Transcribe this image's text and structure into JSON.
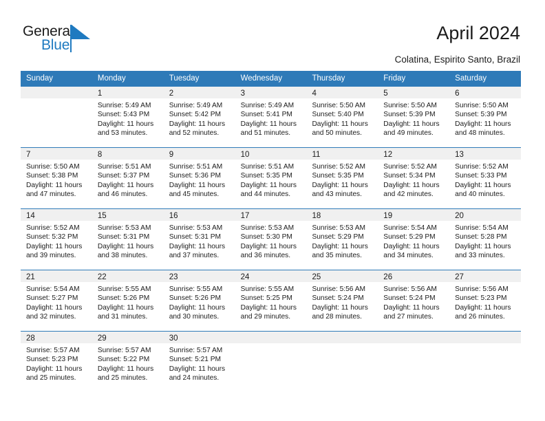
{
  "logo": {
    "text_top": "General",
    "text_bottom": "Blue",
    "triangle_color": "#1f7ac0",
    "icon": "general-blue-logo"
  },
  "header": {
    "title": "April 2024",
    "subtitle": "Colatina, Espirito Santo, Brazil"
  },
  "colors": {
    "header_blue": "#2e7ab8",
    "day_band_gray": "#f0f0f0",
    "text": "#1b1b1b",
    "logo_blue": "#1f7ac0"
  },
  "weekdays": [
    "Sunday",
    "Monday",
    "Tuesday",
    "Wednesday",
    "Thursday",
    "Friday",
    "Saturday"
  ],
  "weeks": [
    [
      {
        "day": "",
        "sunrise": "",
        "sunset": "",
        "daylight_line1": "",
        "daylight_line2": ""
      },
      {
        "day": "1",
        "sunrise": "Sunrise: 5:49 AM",
        "sunset": "Sunset: 5:43 PM",
        "daylight_line1": "Daylight: 11 hours",
        "daylight_line2": "and 53 minutes."
      },
      {
        "day": "2",
        "sunrise": "Sunrise: 5:49 AM",
        "sunset": "Sunset: 5:42 PM",
        "daylight_line1": "Daylight: 11 hours",
        "daylight_line2": "and 52 minutes."
      },
      {
        "day": "3",
        "sunrise": "Sunrise: 5:49 AM",
        "sunset": "Sunset: 5:41 PM",
        "daylight_line1": "Daylight: 11 hours",
        "daylight_line2": "and 51 minutes."
      },
      {
        "day": "4",
        "sunrise": "Sunrise: 5:50 AM",
        "sunset": "Sunset: 5:40 PM",
        "daylight_line1": "Daylight: 11 hours",
        "daylight_line2": "and 50 minutes."
      },
      {
        "day": "5",
        "sunrise": "Sunrise: 5:50 AM",
        "sunset": "Sunset: 5:39 PM",
        "daylight_line1": "Daylight: 11 hours",
        "daylight_line2": "and 49 minutes."
      },
      {
        "day": "6",
        "sunrise": "Sunrise: 5:50 AM",
        "sunset": "Sunset: 5:39 PM",
        "daylight_line1": "Daylight: 11 hours",
        "daylight_line2": "and 48 minutes."
      }
    ],
    [
      {
        "day": "7",
        "sunrise": "Sunrise: 5:50 AM",
        "sunset": "Sunset: 5:38 PM",
        "daylight_line1": "Daylight: 11 hours",
        "daylight_line2": "and 47 minutes."
      },
      {
        "day": "8",
        "sunrise": "Sunrise: 5:51 AM",
        "sunset": "Sunset: 5:37 PM",
        "daylight_line1": "Daylight: 11 hours",
        "daylight_line2": "and 46 minutes."
      },
      {
        "day": "9",
        "sunrise": "Sunrise: 5:51 AM",
        "sunset": "Sunset: 5:36 PM",
        "daylight_line1": "Daylight: 11 hours",
        "daylight_line2": "and 45 minutes."
      },
      {
        "day": "10",
        "sunrise": "Sunrise: 5:51 AM",
        "sunset": "Sunset: 5:35 PM",
        "daylight_line1": "Daylight: 11 hours",
        "daylight_line2": "and 44 minutes."
      },
      {
        "day": "11",
        "sunrise": "Sunrise: 5:52 AM",
        "sunset": "Sunset: 5:35 PM",
        "daylight_line1": "Daylight: 11 hours",
        "daylight_line2": "and 43 minutes."
      },
      {
        "day": "12",
        "sunrise": "Sunrise: 5:52 AM",
        "sunset": "Sunset: 5:34 PM",
        "daylight_line1": "Daylight: 11 hours",
        "daylight_line2": "and 42 minutes."
      },
      {
        "day": "13",
        "sunrise": "Sunrise: 5:52 AM",
        "sunset": "Sunset: 5:33 PM",
        "daylight_line1": "Daylight: 11 hours",
        "daylight_line2": "and 40 minutes."
      }
    ],
    [
      {
        "day": "14",
        "sunrise": "Sunrise: 5:52 AM",
        "sunset": "Sunset: 5:32 PM",
        "daylight_line1": "Daylight: 11 hours",
        "daylight_line2": "and 39 minutes."
      },
      {
        "day": "15",
        "sunrise": "Sunrise: 5:53 AM",
        "sunset": "Sunset: 5:31 PM",
        "daylight_line1": "Daylight: 11 hours",
        "daylight_line2": "and 38 minutes."
      },
      {
        "day": "16",
        "sunrise": "Sunrise: 5:53 AM",
        "sunset": "Sunset: 5:31 PM",
        "daylight_line1": "Daylight: 11 hours",
        "daylight_line2": "and 37 minutes."
      },
      {
        "day": "17",
        "sunrise": "Sunrise: 5:53 AM",
        "sunset": "Sunset: 5:30 PM",
        "daylight_line1": "Daylight: 11 hours",
        "daylight_line2": "and 36 minutes."
      },
      {
        "day": "18",
        "sunrise": "Sunrise: 5:53 AM",
        "sunset": "Sunset: 5:29 PM",
        "daylight_line1": "Daylight: 11 hours",
        "daylight_line2": "and 35 minutes."
      },
      {
        "day": "19",
        "sunrise": "Sunrise: 5:54 AM",
        "sunset": "Sunset: 5:29 PM",
        "daylight_line1": "Daylight: 11 hours",
        "daylight_line2": "and 34 minutes."
      },
      {
        "day": "20",
        "sunrise": "Sunrise: 5:54 AM",
        "sunset": "Sunset: 5:28 PM",
        "daylight_line1": "Daylight: 11 hours",
        "daylight_line2": "and 33 minutes."
      }
    ],
    [
      {
        "day": "21",
        "sunrise": "Sunrise: 5:54 AM",
        "sunset": "Sunset: 5:27 PM",
        "daylight_line1": "Daylight: 11 hours",
        "daylight_line2": "and 32 minutes."
      },
      {
        "day": "22",
        "sunrise": "Sunrise: 5:55 AM",
        "sunset": "Sunset: 5:26 PM",
        "daylight_line1": "Daylight: 11 hours",
        "daylight_line2": "and 31 minutes."
      },
      {
        "day": "23",
        "sunrise": "Sunrise: 5:55 AM",
        "sunset": "Sunset: 5:26 PM",
        "daylight_line1": "Daylight: 11 hours",
        "daylight_line2": "and 30 minutes."
      },
      {
        "day": "24",
        "sunrise": "Sunrise: 5:55 AM",
        "sunset": "Sunset: 5:25 PM",
        "daylight_line1": "Daylight: 11 hours",
        "daylight_line2": "and 29 minutes."
      },
      {
        "day": "25",
        "sunrise": "Sunrise: 5:56 AM",
        "sunset": "Sunset: 5:24 PM",
        "daylight_line1": "Daylight: 11 hours",
        "daylight_line2": "and 28 minutes."
      },
      {
        "day": "26",
        "sunrise": "Sunrise: 5:56 AM",
        "sunset": "Sunset: 5:24 PM",
        "daylight_line1": "Daylight: 11 hours",
        "daylight_line2": "and 27 minutes."
      },
      {
        "day": "27",
        "sunrise": "Sunrise: 5:56 AM",
        "sunset": "Sunset: 5:23 PM",
        "daylight_line1": "Daylight: 11 hours",
        "daylight_line2": "and 26 minutes."
      }
    ],
    [
      {
        "day": "28",
        "sunrise": "Sunrise: 5:57 AM",
        "sunset": "Sunset: 5:23 PM",
        "daylight_line1": "Daylight: 11 hours",
        "daylight_line2": "and 25 minutes."
      },
      {
        "day": "29",
        "sunrise": "Sunrise: 5:57 AM",
        "sunset": "Sunset: 5:22 PM",
        "daylight_line1": "Daylight: 11 hours",
        "daylight_line2": "and 25 minutes."
      },
      {
        "day": "30",
        "sunrise": "Sunrise: 5:57 AM",
        "sunset": "Sunset: 5:21 PM",
        "daylight_line1": "Daylight: 11 hours",
        "daylight_line2": "and 24 minutes."
      },
      {
        "day": "",
        "sunrise": "",
        "sunset": "",
        "daylight_line1": "",
        "daylight_line2": ""
      },
      {
        "day": "",
        "sunrise": "",
        "sunset": "",
        "daylight_line1": "",
        "daylight_line2": ""
      },
      {
        "day": "",
        "sunrise": "",
        "sunset": "",
        "daylight_line1": "",
        "daylight_line2": ""
      },
      {
        "day": "",
        "sunrise": "",
        "sunset": "",
        "daylight_line1": "",
        "daylight_line2": ""
      }
    ]
  ]
}
